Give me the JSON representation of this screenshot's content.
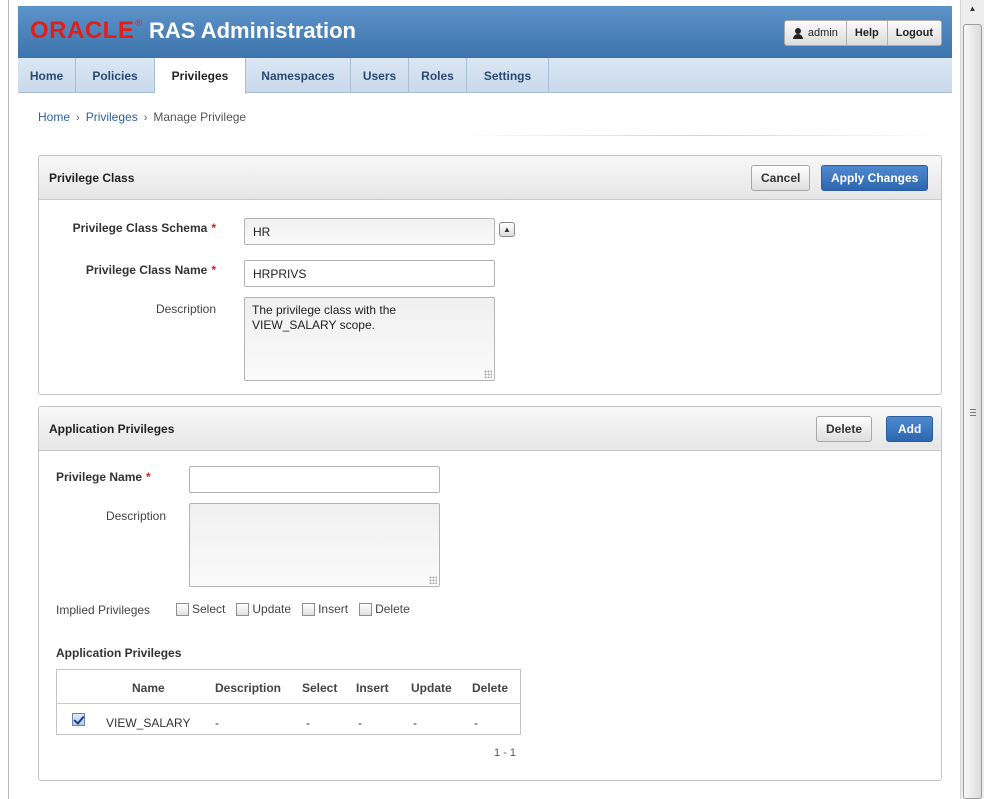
{
  "header": {
    "brand": "ORACLE",
    "reg": "®",
    "title": "RAS Administration",
    "user": "admin",
    "help": "Help",
    "logout": "Logout"
  },
  "nav": {
    "tabs": [
      "Home",
      "Policies",
      "Privileges",
      "Namespaces",
      "Users",
      "Roles",
      "Settings"
    ],
    "active": "Privileges"
  },
  "breadcrumb": {
    "home": "Home",
    "privileges": "Privileges",
    "current": "Manage Privilege",
    "sep": "›"
  },
  "privilege_class": {
    "title": "Privilege Class",
    "cancel": "Cancel",
    "apply": "Apply Changes",
    "schema_label": "Privilege Class Schema",
    "schema_value": "HR",
    "name_label": "Privilege Class Name",
    "name_value": "HRPRIVS",
    "description_label": "Description",
    "description_value": "The privilege class with the VIEW_SALARY scope.",
    "required_mark": "*"
  },
  "app_privileges": {
    "title": "Application Privileges",
    "delete": "Delete",
    "add": "Add",
    "name_label": "Privilege Name",
    "name_value": "",
    "description_label": "Description",
    "description_value": "",
    "implied_label": "Implied Privileges",
    "implied_options": [
      "Select",
      "Update",
      "Insert",
      "Delete"
    ],
    "subheading": "Application Privileges",
    "columns": [
      "Name",
      "Description",
      "Select",
      "Insert",
      "Update",
      "Delete"
    ],
    "rows": [
      {
        "checked": true,
        "name": "VIEW_SALARY",
        "description": "-",
        "select": "-",
        "insert": "-",
        "update": "-",
        "delete": "-"
      }
    ],
    "pagination": "1 - 1"
  },
  "icons": {
    "user": "person-icon",
    "collapse": "caret-up-icon",
    "scroll_up": "arrow-up-icon"
  },
  "colors": {
    "brand_red": "#e21e19",
    "header_blue": "#4a80bb",
    "button_blue": "#3a74bc"
  }
}
